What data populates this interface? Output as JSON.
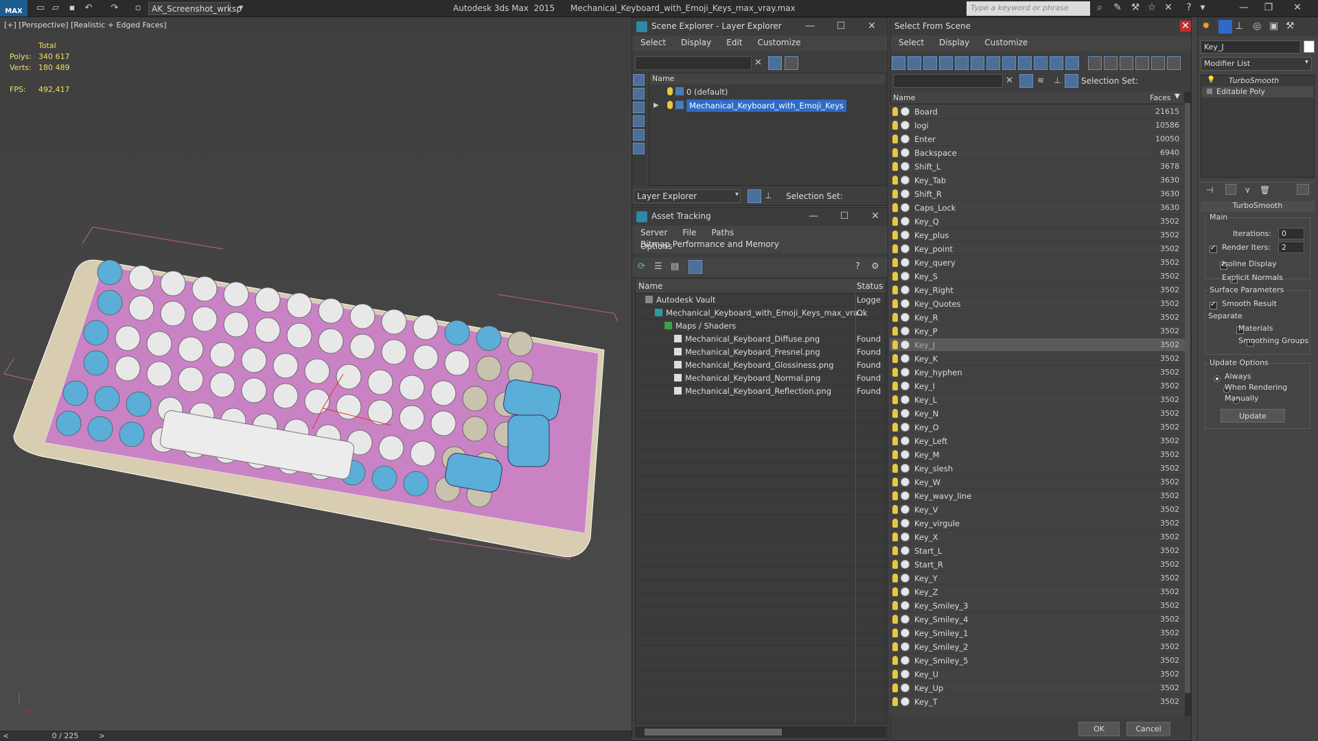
{
  "app": {
    "logo": "MAX",
    "workspace": "AK_Screenshot_wrksp",
    "title": "Autodesk 3ds Max  2015      Mechanical_Keyboard_with_Emoji_Keys_max_vray.max",
    "search_placeholder": "Type a keyword or phrase"
  },
  "viewport": {
    "label": "[+] [Perspective] [Realistic + Edged Faces]",
    "stats": {
      "total_label": "Total",
      "polys_label": "Polys:",
      "polys_value": "340 617",
      "verts_label": "Verts:",
      "verts_value": "180 489",
      "fps_label": "FPS:",
      "fps_value": "492,417"
    },
    "frame_counter": "0 / 225"
  },
  "scene_explorer": {
    "title": "Scene Explorer - Layer Explorer",
    "menu": [
      "Select",
      "Display",
      "Edit",
      "Customize"
    ],
    "column_name": "Name",
    "layers": [
      {
        "name": "0 (default)",
        "selected": false
      },
      {
        "name": "Mechanical_Keyboard_with_Emoji_Keys",
        "selected": true
      }
    ],
    "footer_dropdown": "Layer Explorer",
    "selection_set_label": "Selection Set:"
  },
  "asset_tracking": {
    "title": "Asset Tracking",
    "menu": [
      "Server",
      "File",
      "Paths",
      "Bitmap Performance and Memory"
    ],
    "menu2": [
      "Options"
    ],
    "col_name": "Name",
    "col_status": "Status",
    "rows": [
      {
        "name": "Autodesk Vault",
        "status": "Logge",
        "indent": 1
      },
      {
        "name": "Mechanical_Keyboard_with_Emoji_Keys_max_vra...",
        "status": "Ok",
        "indent": 2
      },
      {
        "name": "Maps / Shaders",
        "status": "",
        "indent": 3
      },
      {
        "name": "Mechanical_Keyboard_Diffuse.png",
        "status": "Found",
        "indent": 4
      },
      {
        "name": "Mechanical_Keyboard_Fresnel.png",
        "status": "Found",
        "indent": 4
      },
      {
        "name": "Mechanical_Keyboard_Glossiness.png",
        "status": "Found",
        "indent": 4
      },
      {
        "name": "Mechanical_Keyboard_Normal.png",
        "status": "Found",
        "indent": 4
      },
      {
        "name": "Mechanical_Keyboard_Reflection.png",
        "status": "Found",
        "indent": 4
      }
    ]
  },
  "select_from_scene": {
    "title": "Select From Scene",
    "menu": [
      "Select",
      "Display",
      "Customize"
    ],
    "selection_set_label": "Selection Set:",
    "col_name": "Name",
    "col_faces": "Faces",
    "ok_label": "OK",
    "cancel_label": "Cancel",
    "rows": [
      {
        "name": "Board",
        "faces": "21615"
      },
      {
        "name": "logi",
        "faces": "10586"
      },
      {
        "name": "Enter",
        "faces": "10050"
      },
      {
        "name": "Backspace",
        "faces": "6940"
      },
      {
        "name": "Shift_L",
        "faces": "3678"
      },
      {
        "name": "Key_Tab",
        "faces": "3630"
      },
      {
        "name": "Shift_R",
        "faces": "3630"
      },
      {
        "name": "Caps_Lock",
        "faces": "3630"
      },
      {
        "name": "Key_Q",
        "faces": "3502"
      },
      {
        "name": "Key_plus",
        "faces": "3502"
      },
      {
        "name": "Key_point",
        "faces": "3502"
      },
      {
        "name": "Key_query",
        "faces": "3502"
      },
      {
        "name": "Key_S",
        "faces": "3502"
      },
      {
        "name": "Key_Right",
        "faces": "3502"
      },
      {
        "name": "Key_Quotes",
        "faces": "3502"
      },
      {
        "name": "Key_R",
        "faces": "3502"
      },
      {
        "name": "Key_P",
        "faces": "3502"
      },
      {
        "name": "Key_J",
        "faces": "3502",
        "selected": true
      },
      {
        "name": "Key_K",
        "faces": "3502"
      },
      {
        "name": "Key_hyphen",
        "faces": "3502"
      },
      {
        "name": "Key_I",
        "faces": "3502"
      },
      {
        "name": "Key_L",
        "faces": "3502"
      },
      {
        "name": "Key_N",
        "faces": "3502"
      },
      {
        "name": "Key_O",
        "faces": "3502"
      },
      {
        "name": "Key_Left",
        "faces": "3502"
      },
      {
        "name": "Key_M",
        "faces": "3502"
      },
      {
        "name": "Key_slesh",
        "faces": "3502"
      },
      {
        "name": "Key_W",
        "faces": "3502"
      },
      {
        "name": "Key_wavy_line",
        "faces": "3502"
      },
      {
        "name": "Key_V",
        "faces": "3502"
      },
      {
        "name": "Key_virgule",
        "faces": "3502"
      },
      {
        "name": "Key_X",
        "faces": "3502"
      },
      {
        "name": "Start_L",
        "faces": "3502"
      },
      {
        "name": "Start_R",
        "faces": "3502"
      },
      {
        "name": "Key_Y",
        "faces": "3502"
      },
      {
        "name": "Key_Z",
        "faces": "3502"
      },
      {
        "name": "Key_Smiley_3",
        "faces": "3502"
      },
      {
        "name": "Key_Smiley_4",
        "faces": "3502"
      },
      {
        "name": "Key_Smiley_1",
        "faces": "3502"
      },
      {
        "name": "Key_Smiley_2",
        "faces": "3502"
      },
      {
        "name": "Key_Smiley_5",
        "faces": "3502"
      },
      {
        "name": "Key_U",
        "faces": "3502"
      },
      {
        "name": "Key_Up",
        "faces": "3502"
      },
      {
        "name": "Key_T",
        "faces": "3502"
      }
    ]
  },
  "command_panel": {
    "object_name": "Key_J",
    "modifier_list": "Modifier List",
    "stack": [
      "TurboSmooth",
      "Editable Poly"
    ],
    "rollout_title": "TurboSmooth",
    "main_group": "Main",
    "iterations_label": "Iterations:",
    "iterations_value": "0",
    "render_iters_label": "Render Iters:",
    "render_iters_value": "2",
    "isoline_label": "Isoline Display",
    "explicit_normals_label": "Explicit Normals",
    "surface_group": "Surface Parameters",
    "smooth_result_label": "Smooth Result",
    "separate_label": "Separate",
    "materials_label": "Materials",
    "smoothing_groups_label": "Smoothing Groups",
    "update_group": "Update Options",
    "always_label": "Always",
    "when_rendering_label": "When Rendering",
    "manually_label": "Manually",
    "update_button": "Update"
  },
  "colors": {
    "key_blue": "#5aaed8",
    "key_white": "#e8e8e8",
    "key_gray": "#c9c2ae",
    "board_pink": "#c983c4",
    "selection_blue": "#2e6ac8",
    "stat_yellow": "#f0e060"
  }
}
